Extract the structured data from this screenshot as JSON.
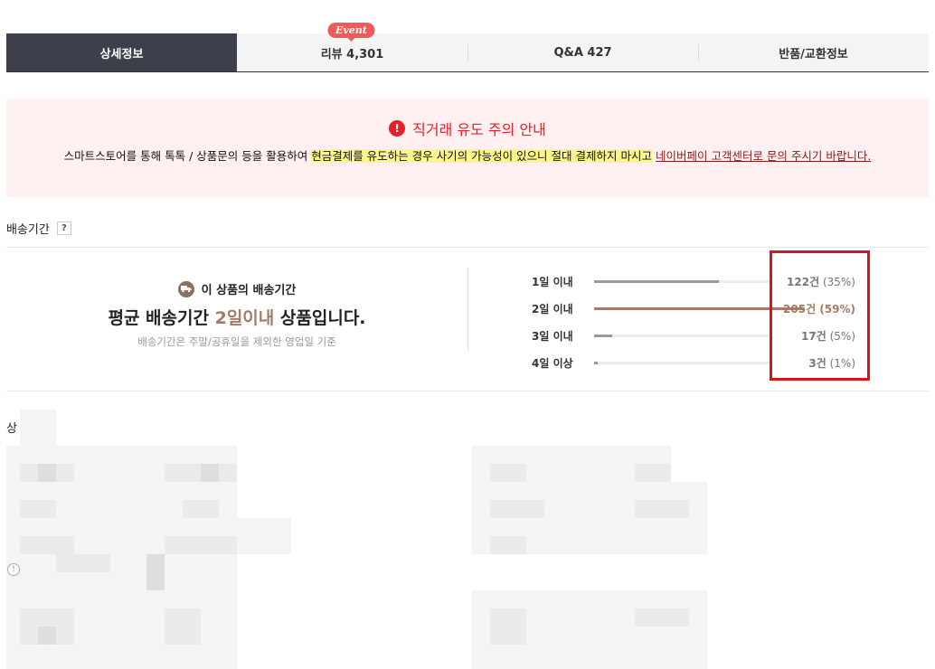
{
  "tabs": [
    {
      "label": "상세정보",
      "active": true
    },
    {
      "label": "리뷰 4,301",
      "badge": "Event"
    },
    {
      "label": "Q&A 427"
    },
    {
      "label": "반품/교환정보"
    }
  ],
  "warning": {
    "title": "직거래 유도 주의 안내",
    "text_before": "스마트스토어를 통해 톡톡 / 상품문의 등을 활용하여 ",
    "highlight": "현금결제를 유도하는 경우 사기의 가능성이 있으니 절대 결제하지 마시고",
    "text_middle": " ",
    "link": "네이버페이 고객센터로 문의 주시기 바랍니다."
  },
  "delivery": {
    "header": "배송기간",
    "help": "?",
    "subtitle": "이 상품의 배송기간",
    "main_prefix": "평균 배송기간 ",
    "main_accent": "2일이내",
    "main_suffix": " 상품입니다.",
    "note": "배송기간은 주말/공휴일을 제외한 영업일 기준",
    "stats": [
      {
        "label": "1일 이내",
        "count": "122건",
        "pct": "(35%)",
        "value": 35
      },
      {
        "label": "2일 이내",
        "count": "205건",
        "pct": "(59%)",
        "value": 59
      },
      {
        "label": "3일 이내",
        "count": "17건",
        "pct": "(5%)",
        "value": 5
      },
      {
        "label": "4일 이상",
        "count": "3건",
        "pct": "(1%)",
        "value": 1
      }
    ]
  },
  "colors": {
    "accent": "#a37b68",
    "tab_active": "#3d3f4a",
    "warning_red": "#e4202a",
    "highlight": "#fcf58b"
  },
  "partial": {
    "label": "상"
  }
}
